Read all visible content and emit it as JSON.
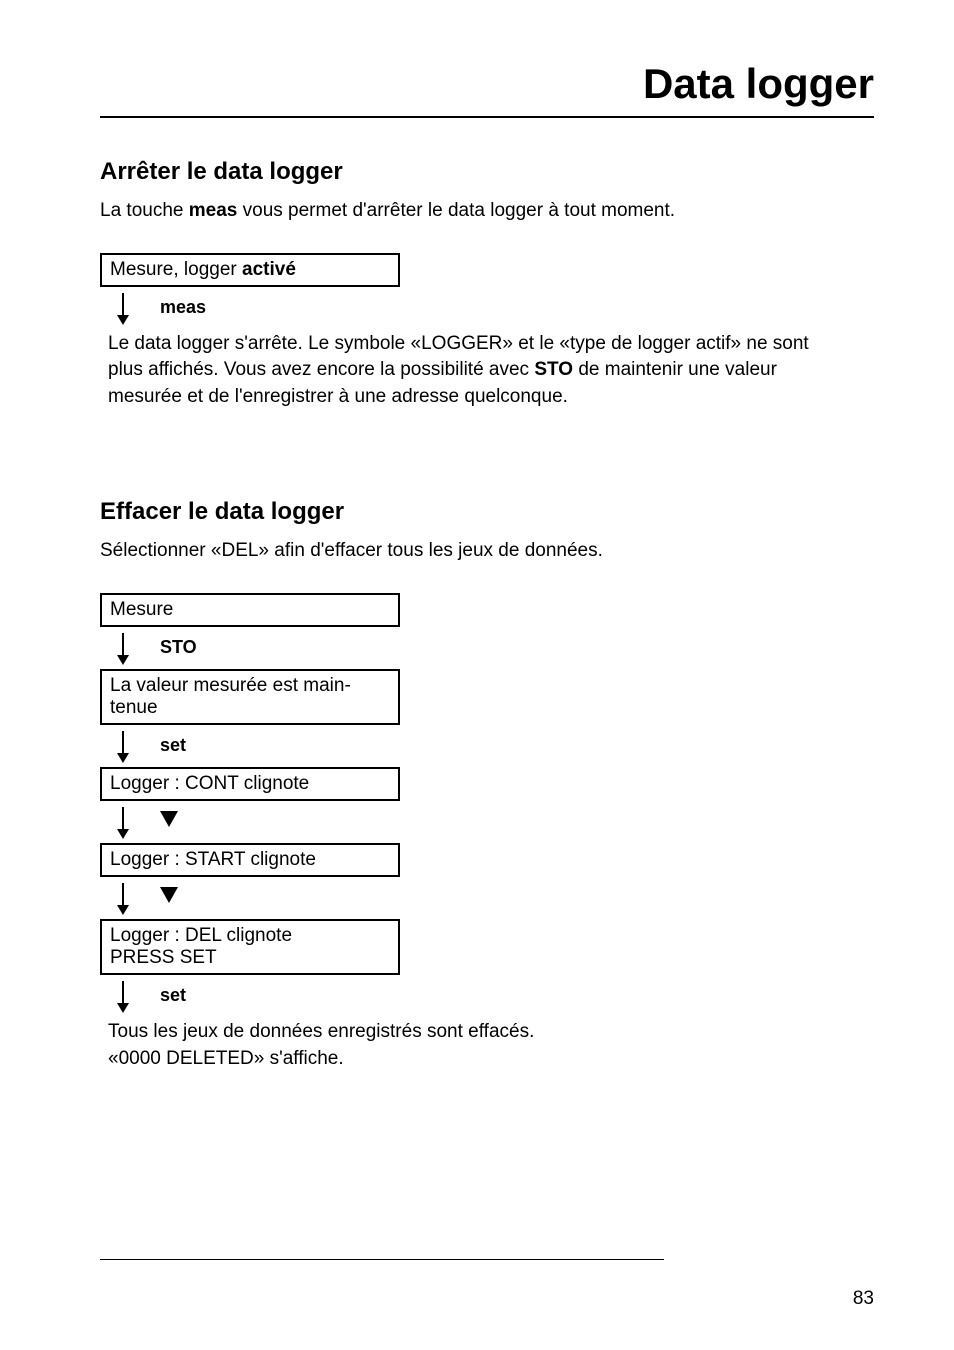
{
  "page_title": "Data logger",
  "section_a": {
    "heading": "Arrêter le data logger",
    "intro_pre": "La touche ",
    "intro_bold": "meas",
    "intro_post": " vous permet d'arrêter le data logger à tout moment.",
    "box_pre": "Mesure, logger ",
    "box_bold": "activé",
    "arrow_label": "meas",
    "result_pre": "Le data logger s'arrête. Le symbole «LOGGER» et le «type de logger actif» ne sont plus affichés. Vous avez encore la possibilité avec ",
    "result_bold": "STO",
    "result_post": " de maintenir une valeur mesurée et de l'enregistrer à une adresse quelconque."
  },
  "section_b": {
    "heading": "Effacer le data logger",
    "intro": "Sélectionner «DEL» afin d'effacer tous les jeux de données.",
    "step1": "Mesure",
    "a1": "STO",
    "step2": "La valeur mesurée est main­tenue",
    "a2": "set",
    "step3": "Logger : CONT clignote",
    "step4": "Logger : START clignote",
    "step5_l1": "Logger : DEL clignote",
    "step5_l2": "PRESS SET",
    "a5": "set",
    "result_l1": "Tous les jeux de données enregistrés sont effacés.",
    "result_l2": "«0000 DELETED» s'affiche."
  },
  "page_number": "83"
}
